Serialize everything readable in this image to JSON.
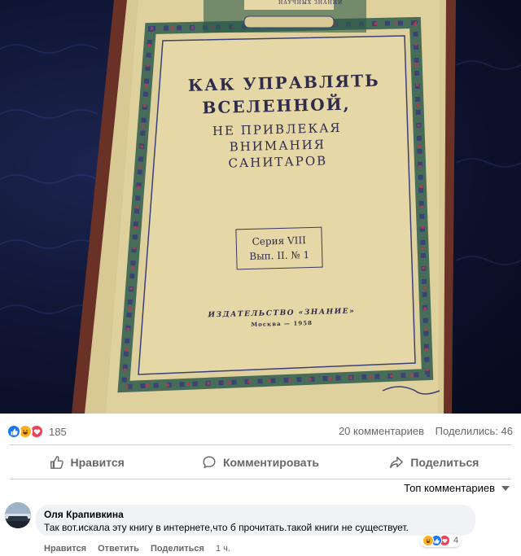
{
  "photo": {
    "banner": "НАУЧНЫХ ЗНАНИЙ",
    "title_lines": [
      "КАК УПРАВЛЯТЬ",
      "ВСЕЛЕННОЙ,",
      "НЕ ПРИВЛЕКАЯ",
      "ВНИМАНИЯ",
      "САНИТАРОВ"
    ],
    "series_lines": [
      "Серия VIII",
      "Вып. II. № 1"
    ],
    "publisher": "ИЗДАТЕЛЬСТВО «ЗНАНИЕ»",
    "city_year": "Москва — 1958"
  },
  "stats": {
    "reaction_count": "185",
    "comments": "20 комментариев",
    "shares": "Поделились: 46"
  },
  "actions": {
    "like": "Нравится",
    "comment": "Комментировать",
    "share": "Поделиться"
  },
  "sort": {
    "label": "Топ комментариев"
  },
  "comment": {
    "author": "Оля Крапивкина",
    "text": "Так вот.искала эту книгу в интернете,что б прочитать.такой книги не существует.",
    "reaction_count": "4",
    "like": "Нравится",
    "reply": "Ответить",
    "share": "Поделиться",
    "time": "1 ч."
  },
  "colors": {
    "like": "#1877f2",
    "haha": "#f7b125",
    "love": "#f33e58",
    "cover": "#dccd97",
    "muted_text": "#65676b"
  }
}
